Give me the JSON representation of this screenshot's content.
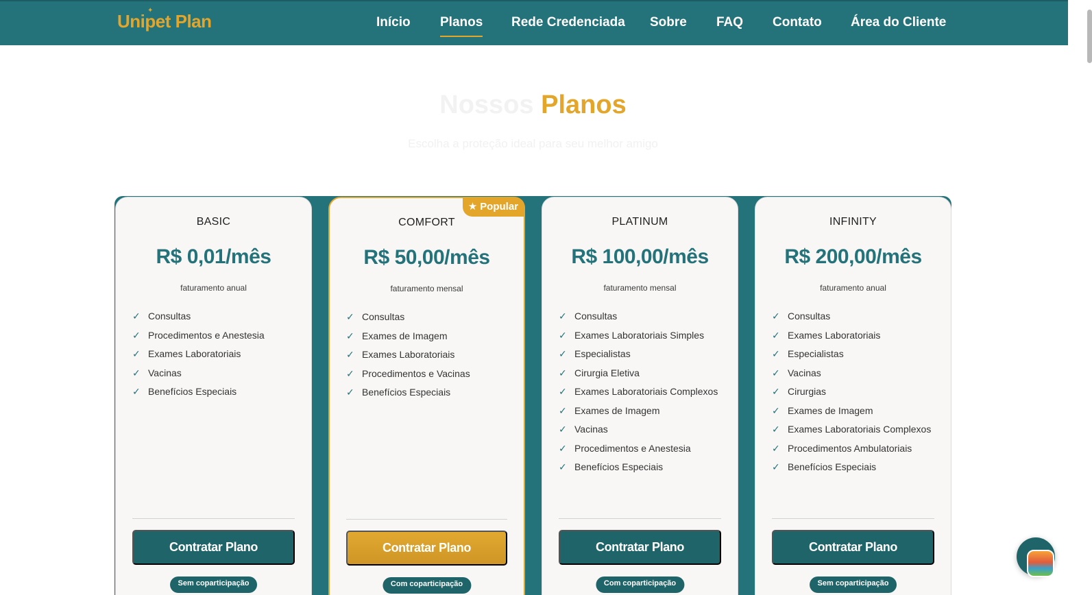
{
  "header": {
    "logo": "Unipet Plan",
    "nav": [
      {
        "label": "Início",
        "active": false
      },
      {
        "label": "Planos",
        "active": true
      },
      {
        "label": "Rede Credenciada",
        "active": false
      },
      {
        "label": "Sobre",
        "active": false
      },
      {
        "label": "FAQ",
        "active": false
      },
      {
        "label": "Contato",
        "active": false
      },
      {
        "label": "Área do Cliente",
        "active": false
      }
    ]
  },
  "section": {
    "title_part1": "Nossos",
    "title_part2": "Planos",
    "subtitle": "Escolha a proteção ideal para seu melhor amigo"
  },
  "plans": [
    {
      "name": "BASIC",
      "price": "R$ 0,01/mês",
      "billing": "faturamento anual",
      "features": [
        "Consultas",
        "Procedimentos e Anestesia",
        "Exames Laboratoriais",
        "Vacinas",
        "Benefícios Especiais"
      ],
      "button": "Contratar Plano",
      "tag": "Sem coparticipação",
      "popular": false
    },
    {
      "name": "COMFORT",
      "price": "R$ 50,00/mês",
      "billing": "faturamento mensal",
      "features": [
        "Consultas",
        "Exames de Imagem",
        "Exames Laboratoriais",
        "Procedimentos e Vacinas",
        "Benefícios Especiais"
      ],
      "button": "Contratar Plano",
      "tag": "Com coparticipação",
      "popular": true,
      "badge": "Popular"
    },
    {
      "name": "PLATINUM",
      "price": "R$ 100,00/mês",
      "billing": "faturamento mensal",
      "features": [
        "Consultas",
        "Exames Laboratoriais Simples",
        "Especialistas",
        "Cirurgia Eletiva",
        "Exames Laboratoriais Complexos",
        "Exames de Imagem",
        "Vacinas",
        "Procedimentos e Anestesia",
        "Benefícios Especiais"
      ],
      "button": "Contratar Plano",
      "tag": "Com coparticipação",
      "popular": false
    },
    {
      "name": "INFINITY",
      "price": "R$ 200,00/mês",
      "billing": "faturamento anual",
      "features": [
        "Consultas",
        "Exames Laboratoriais",
        "Especialistas",
        "Vacinas",
        "Cirurgias",
        "Exames de Imagem",
        "Exames Laboratoriais Complexos",
        "Procedimentos Ambulatoriais",
        "Benefícios Especiais"
      ],
      "button": "Contratar Plano",
      "tag": "Sem coparticipação",
      "popular": false
    }
  ],
  "icons": {
    "feature": "check-icon",
    "badge": "star-icon",
    "chat": "chat-widget-icon"
  },
  "colors": {
    "primary": "#24727a",
    "accent": "#e3a62a",
    "card_bg": "#f8f7f5"
  }
}
